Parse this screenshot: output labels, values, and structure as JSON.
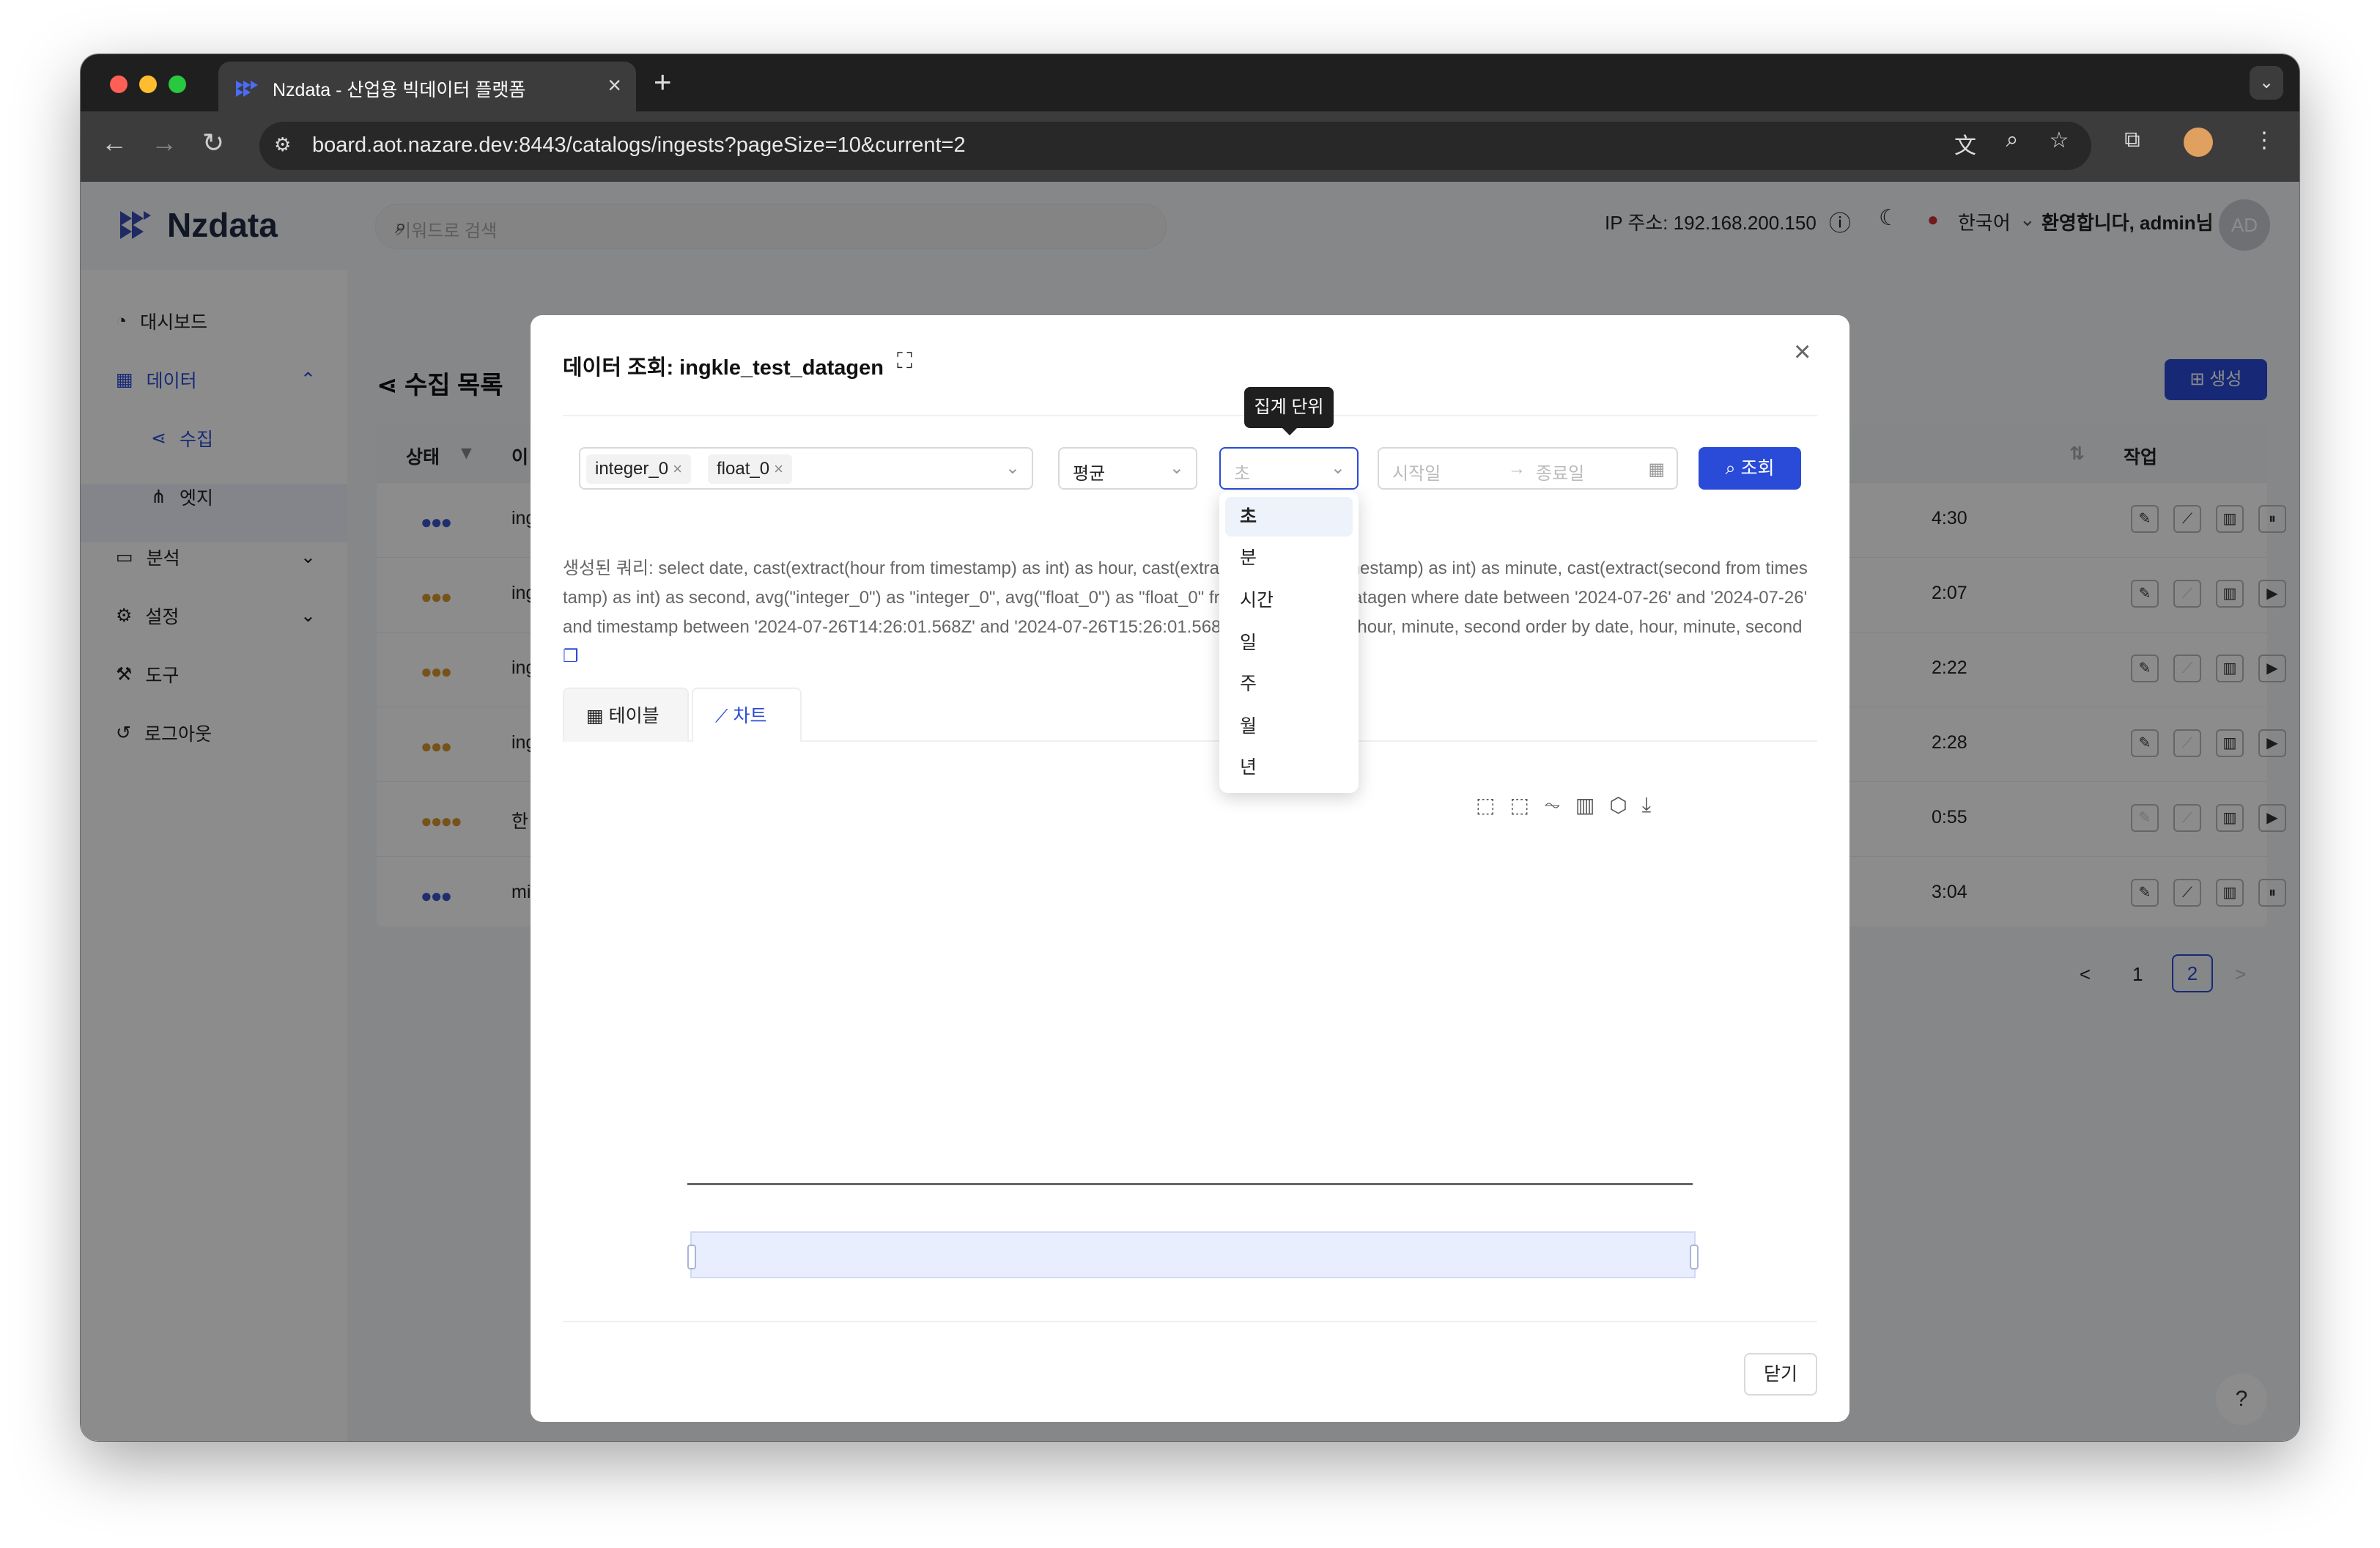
{
  "browser": {
    "tab_title": "Nzdata - 산업용 빅데이터 플랫폼",
    "url": "board.aot.nazare.dev:8443/catalogs/ingests?pageSize=10&current=2",
    "icons": [
      "back-icon",
      "forward-icon",
      "reload-icon",
      "site-info-icon",
      "translate-icon",
      "zoom-icon",
      "bookmark-icon",
      "extensions-icon",
      "profile-icon",
      "menu-icon"
    ]
  },
  "header": {
    "logo": "Nzdata",
    "search_placeholder": "키워드로 검색",
    "ip_label": "IP 주소: 192.168.200.150",
    "language": "한국어",
    "welcome": "환영합니다, admin님",
    "avatar": "AD"
  },
  "sidebar": {
    "items": [
      {
        "label": "대시보드",
        "icon": "dashboard-icon"
      },
      {
        "label": "데이터",
        "icon": "data-icon"
      },
      {
        "label": "수집",
        "icon": "ingest-icon"
      },
      {
        "label": "엣지",
        "icon": "edge-icon"
      },
      {
        "label": "분석",
        "icon": "analysis-icon"
      },
      {
        "label": "설정",
        "icon": "settings-icon"
      },
      {
        "label": "도구",
        "icon": "tools-icon"
      },
      {
        "label": "로그아웃",
        "icon": "logout-icon"
      }
    ],
    "collapse": "<"
  },
  "page": {
    "title": "수집 목록",
    "create_button": "생성",
    "columns": {
      "status": "상태",
      "name": "이",
      "actions": "작업"
    },
    "rows": [
      {
        "name": "ing",
        "time": "4:30"
      },
      {
        "name": "ing",
        "time": "2:07"
      },
      {
        "name": "ing",
        "time": "2:22"
      },
      {
        "name": "ing",
        "time": "2:28"
      },
      {
        "name": "한",
        "time": "0:55"
      },
      {
        "name": "mi",
        "time": "3:04"
      }
    ],
    "pagination": {
      "prev": "<",
      "pages": [
        "1",
        "2"
      ],
      "current": "2",
      "next": ">"
    }
  },
  "modal": {
    "title": "데이터 조회: ingkle_test_datagen",
    "fields": [
      "integer_0",
      "float_0"
    ],
    "aggregation": "평균",
    "unit_placeholder": "초",
    "start_placeholder": "시작일",
    "end_placeholder": "종료일",
    "query_button": "조회",
    "tooltip": "집계 단위",
    "unit_options": [
      "초",
      "분",
      "시간",
      "일",
      "주",
      "월",
      "년"
    ],
    "sql": "생성된 쿼리: select date, cast(extract(hour from timestamp) as int) as hour, cast(extract(minute from timestamp) as int) as minute, cast(extract(second from timestamp) as int) as second, avg(\"integer_0\") as \"integer_0\", avg(\"float_0\") as \"float_0\" from ingkle_test_datagen where date between '2024-07-26' and '2024-07-26' and timestamp between '2024-07-26T14:26:01.568Z' and '2024-07-26T15:26:01.568Z' group by date, hour, minute, second order by date, hour, minute, second",
    "tabs": [
      "테이블",
      "차트"
    ],
    "close_button": "닫기"
  }
}
